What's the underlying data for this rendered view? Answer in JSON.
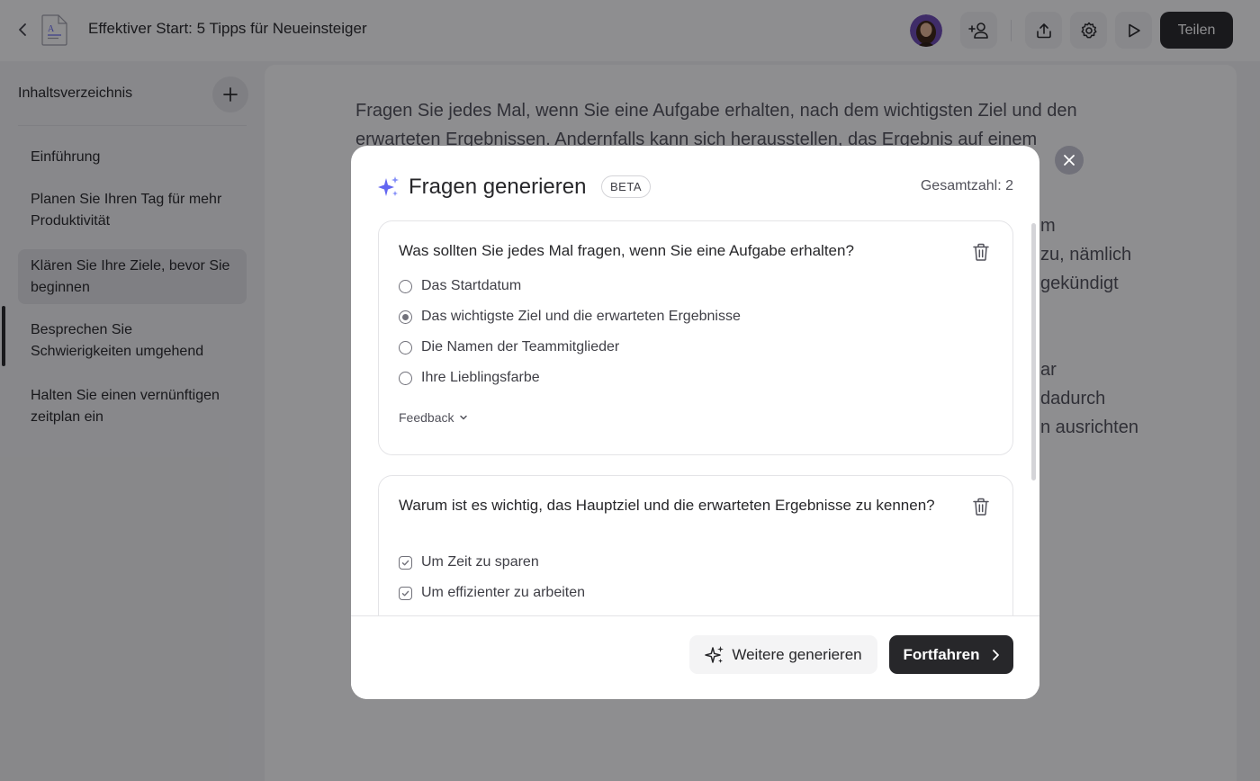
{
  "header": {
    "document_title": "Effektiver Start: 5 Tipps für Neueinsteiger",
    "share_label": "Teilen"
  },
  "sidebar": {
    "title": "Inhaltsverzeichnis",
    "items": [
      {
        "label": "Einführung"
      },
      {
        "label": "Planen Sie Ihren Tag für mehr Produktivität"
      },
      {
        "label": "Klären Sie Ihre Ziele, bevor Sie beginnen",
        "active": true
      },
      {
        "label": "Besprechen Sie Schwierigkeiten umgehend"
      },
      {
        "label": "Halten Sie einen vernünftigen zeitplan ein"
      }
    ]
  },
  "editor": {
    "lines": [
      "Fragen Sie jedes Mal, wenn Sie eine Aufgabe erhalten, nach dem wichtigsten Ziel und den",
      "erwarteten Ergebnissen. Andernfalls kann sich herausstellen, das Ergebnis auf einem",
      "m",
      "zu, nämlich",
      "gekündigt",
      "ar",
      "dadurch",
      "n ausrichten"
    ]
  },
  "modal": {
    "title": "Fragen generieren",
    "badge": "BETA",
    "total_label": "Gesamtzahl: 2",
    "questions": [
      {
        "question": "Was sollten Sie jedes Mal fragen, wenn Sie eine Aufgabe erhalten?",
        "type": "single",
        "options": [
          {
            "label": "Das Startdatum",
            "selected": false
          },
          {
            "label": "Das wichtigste Ziel und die erwarteten Ergebnisse",
            "selected": true
          },
          {
            "label": "Die Namen der Teammitglieder",
            "selected": false
          },
          {
            "label": "Ihre Lieblingsfarbe",
            "selected": false
          }
        ],
        "feedback_label": "Feedback"
      },
      {
        "question": "Warum ist es wichtig, das Hauptziel und die erwarteten Ergebnisse zu kennen?",
        "type": "multiple",
        "options": [
          {
            "label": "Um Zeit zu sparen",
            "selected": true
          },
          {
            "label": "Um effizienter zu arbeiten",
            "selected": true
          }
        ]
      }
    ],
    "generate_more_label": "Weitere generieren",
    "continue_label": "Fortfahren"
  },
  "colors": {
    "primary_dark": "#27272a",
    "sparkle_accent": "#6366f1",
    "overlay": "rgba(8,8,12,0.46)"
  },
  "icons": [
    "back-icon",
    "document-icon",
    "add-user-icon",
    "upload-icon",
    "gear-icon",
    "play-icon",
    "plus-icon",
    "close-icon",
    "sparkle-icon",
    "trash-icon",
    "chevron-down-icon",
    "chevron-right-icon"
  ]
}
